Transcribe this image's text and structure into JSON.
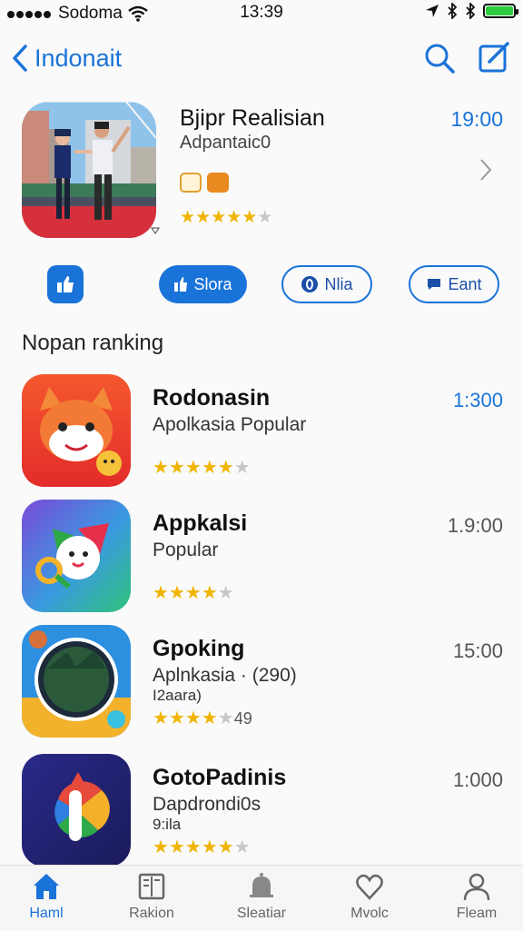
{
  "status": {
    "carrier": "Sodoma",
    "time": "13:39"
  },
  "nav": {
    "back_label": "Indonait"
  },
  "featured": {
    "title": "Bjipr Realisian",
    "subtitle": "Adpantaic0",
    "price": "19:00",
    "rating": 5
  },
  "actions": {
    "solid_label": "Slora",
    "outline1_label": "Nlia",
    "outline2_label": "Eant"
  },
  "section_title": "Nopan ranking",
  "apps": [
    {
      "name": "Rodonasin",
      "subtitle": "Apolkasia Popular",
      "subtitle2": "",
      "price": "1:300",
      "price_color": "#1a73d9",
      "rating": 5,
      "count": ""
    },
    {
      "name": "Appkalsi",
      "subtitle": "Popular",
      "subtitle2": "",
      "price": "1.9:00",
      "price_color": "#555555",
      "rating": 4,
      "count": ""
    },
    {
      "name": "Gpoking",
      "subtitle": "Aplnkasia · (290)",
      "subtitle2": "I2aara)",
      "price": "15:00",
      "price_color": "#555555",
      "rating": 4,
      "count": "49"
    },
    {
      "name": "GotoPadinis",
      "subtitle": "Dapdrondi0s",
      "subtitle2": "9:ila",
      "price": "1:000",
      "price_color": "#555555",
      "rating": 5,
      "count": ""
    }
  ],
  "tabs": [
    {
      "label": "Haml",
      "icon": "home-icon",
      "active": true
    },
    {
      "label": "Rakion",
      "icon": "book-icon",
      "active": false
    },
    {
      "label": "Sleatiar",
      "icon": "bell-icon",
      "active": false
    },
    {
      "label": "Mvolc",
      "icon": "heart-icon",
      "active": false
    },
    {
      "label": "Fleam",
      "icon": "person-icon",
      "active": false
    }
  ],
  "colors": {
    "accent": "#1a73d9",
    "star": "#f0b400",
    "battery": "#2ecc40"
  }
}
